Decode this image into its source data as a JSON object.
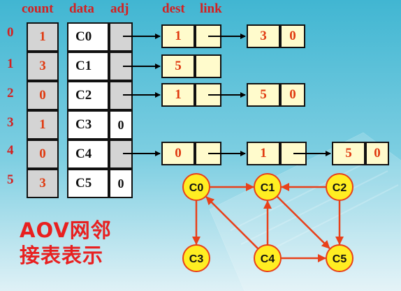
{
  "headers": {
    "count": "count",
    "data": "data",
    "adj": "adj",
    "dest": "dest",
    "link": "link"
  },
  "rows": [
    {
      "index": "0",
      "count": "1",
      "data": "C0",
      "adj": ""
    },
    {
      "index": "1",
      "count": "3",
      "data": "C1",
      "adj": ""
    },
    {
      "index": "2",
      "count": "0",
      "data": "C2",
      "adj": ""
    },
    {
      "index": "3",
      "count": "1",
      "data": "C3",
      "adj": "0"
    },
    {
      "index": "4",
      "count": "0",
      "data": "C4",
      "adj": ""
    },
    {
      "index": "5",
      "count": "3",
      "data": "C5",
      "adj": "0"
    }
  ],
  "edge_nodes": {
    "r0_n1": {
      "dest": "1",
      "link": ""
    },
    "r0_n2": {
      "dest": "3",
      "link": "0"
    },
    "r1_n1": {
      "dest": "5",
      "link": ""
    },
    "r2_n1": {
      "dest": "1",
      "link": ""
    },
    "r2_n2": {
      "dest": "5",
      "link": "0"
    },
    "r4_n1": {
      "dest": "0",
      "link": ""
    },
    "r4_n2": {
      "dest": "1",
      "link": ""
    },
    "r4_n3": {
      "dest": "5",
      "link": "0"
    }
  },
  "graph": {
    "nodes": [
      "C0",
      "C1",
      "C2",
      "C3",
      "C4",
      "C5"
    ],
    "edges": [
      [
        "C0",
        "C1"
      ],
      [
        "C0",
        "C3"
      ],
      [
        "C1",
        "C5"
      ],
      [
        "C2",
        "C1"
      ],
      [
        "C2",
        "C5"
      ],
      [
        "C4",
        "C0"
      ],
      [
        "C4",
        "C1"
      ],
      [
        "C4",
        "C5"
      ]
    ]
  },
  "title_line1": "AOV网邻",
  "title_line2": "接表表示",
  "colors": {
    "background": "#31a6c2",
    "accent_text": "#e03a10",
    "graph_node_fill": "#ffee22",
    "graph_edge": "#e8401a",
    "node_fill": "#fffbcc"
  }
}
